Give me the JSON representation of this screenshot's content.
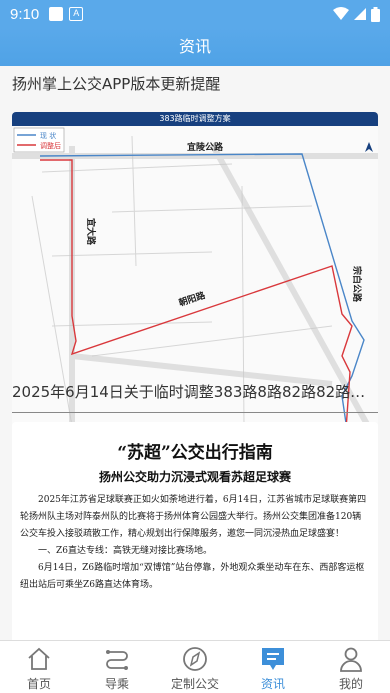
{
  "status": {
    "time": "9:10",
    "badge": "A"
  },
  "header": {
    "title": "资讯"
  },
  "feed": {
    "items": [
      {
        "title": "扬州掌上公交APP版本更新提醒"
      },
      {
        "title": "2025年6月14日关于临时调整383路8路82路82路区间..."
      }
    ],
    "map": {
      "banner": "383路临时调整方案",
      "legend": [
        "现 状",
        "调整后"
      ],
      "roads": [
        "宜陵公路",
        "宜大路",
        "朝阳路",
        "宗白公路"
      ],
      "colors": {
        "current": "#4a86c8",
        "adjusted": "#d9383c"
      }
    },
    "doc": {
      "title": "“苏超”公交出行指南",
      "subtitle": "扬州公交助力沉浸式观看苏超足球赛",
      "paragraphs": [
        "2025年江苏省足球联赛正如火如荼地进行着，6月14日，江苏省城市足球联赛第四轮扬州队主场对阵泰州队的比赛将于扬州体育公园盛大举行。扬州公交集团准备120辆公交车投入接驳疏散工作，精心规划出行保障服务，邀您一同沉浸热血足球盛宴！",
        "一、Z6直达专线：高铁无缝对接比赛场地。",
        "6月14日，Z6路临时增加“双博馆”站台停靠，外地观众乘坐动车在东、西部客运枢纽出站后可乘坐Z6路直达体育场。"
      ]
    }
  },
  "tabbar": {
    "tabs": [
      {
        "label": "首页",
        "icon": "home-icon"
      },
      {
        "label": "导乘",
        "icon": "route-icon"
      },
      {
        "label": "定制公交",
        "icon": "compass-icon"
      },
      {
        "label": "资讯",
        "icon": "news-icon",
        "active": true
      },
      {
        "label": "我的",
        "icon": "user-icon"
      }
    ],
    "active_color": "#3d8fd9"
  }
}
